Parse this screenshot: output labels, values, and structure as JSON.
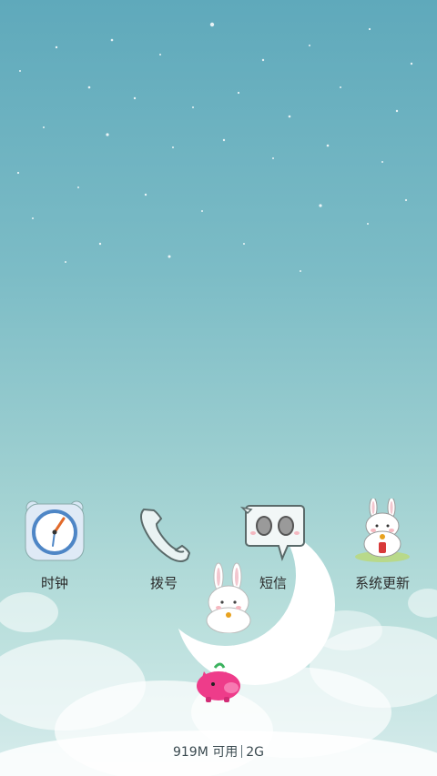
{
  "apps": [
    {
      "label": "时钟",
      "icon": "alarm-clock-icon"
    },
    {
      "label": "拨号",
      "icon": "phone-handset-icon"
    },
    {
      "label": "短信",
      "icon": "speech-bubble-icon"
    },
    {
      "label": "系统更新",
      "icon": "bunny-update-icon"
    }
  ],
  "memory": {
    "free": "919M 可用",
    "network": "2G"
  },
  "colors": {
    "sky_top": "#5fa9bb",
    "sky_bottom": "#d7ecec",
    "label": "#2a2a2a"
  }
}
